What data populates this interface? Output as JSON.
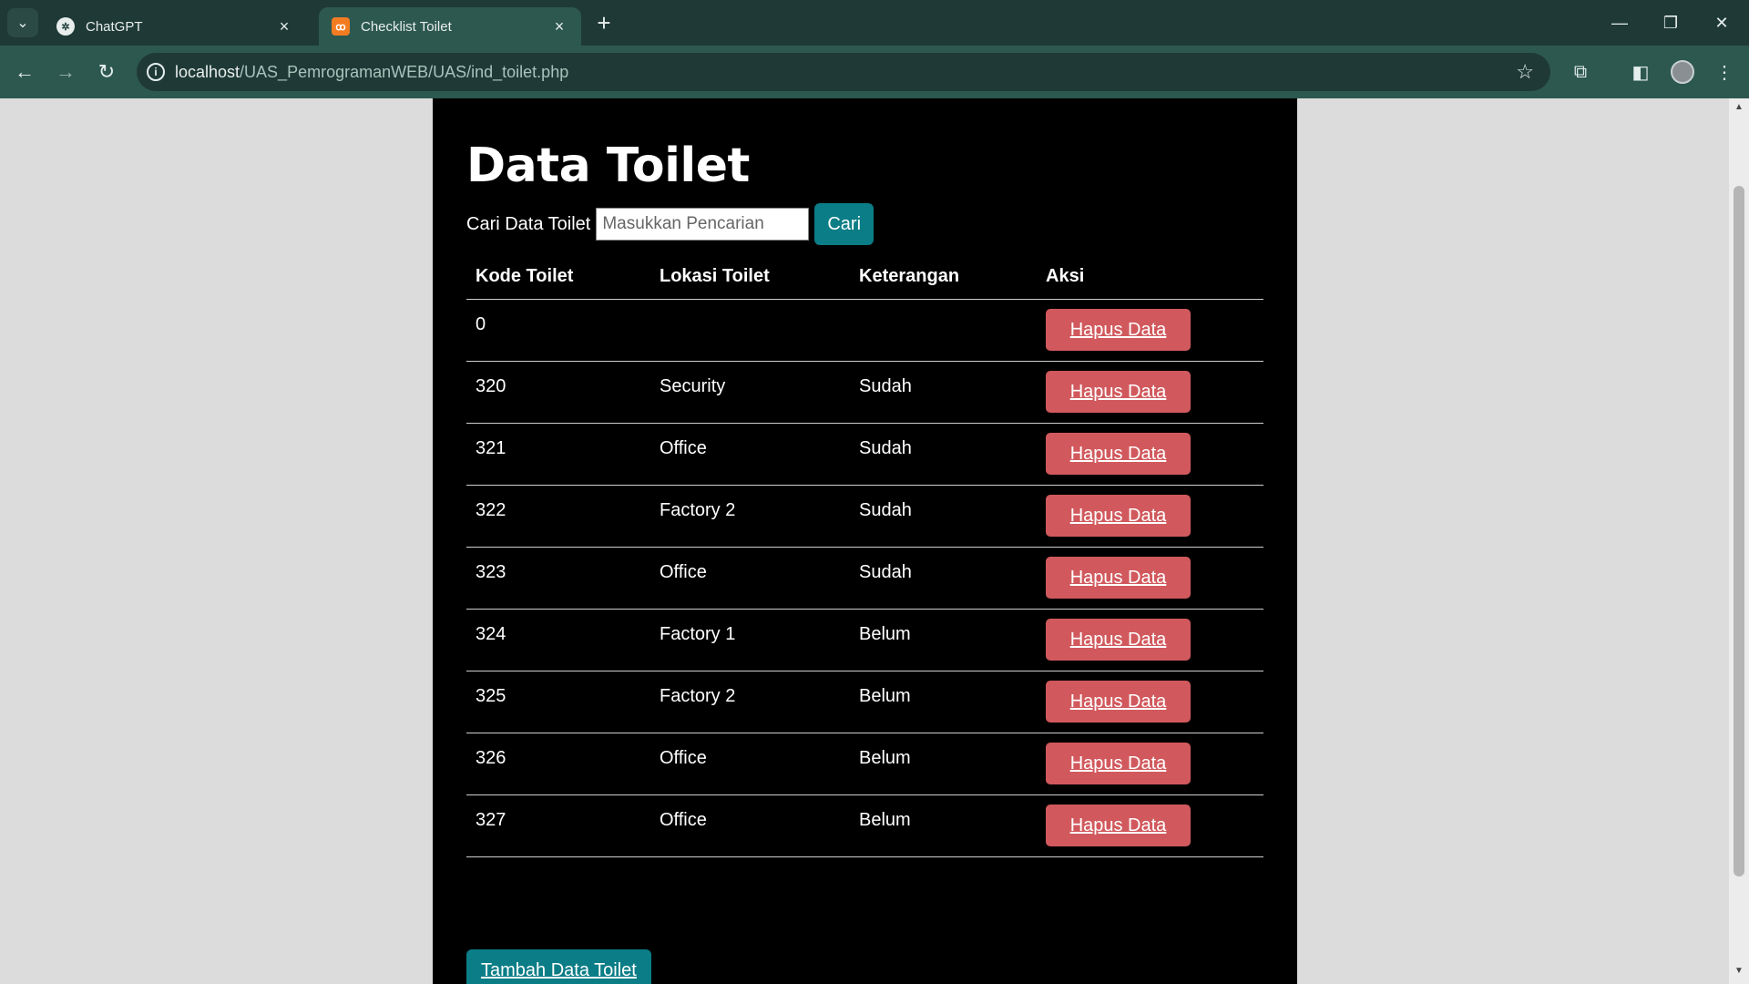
{
  "browser": {
    "tabs": [
      {
        "title": "ChatGPT",
        "favicon": "chatgpt-icon",
        "active": false
      },
      {
        "title": "Checklist Toilet",
        "favicon": "xampp-icon",
        "active": true
      }
    ],
    "url_host": "localhost",
    "url_path": "/UAS_PemrogramanWEB/UAS/ind_toilet.php"
  },
  "page": {
    "title": "Data Toilet",
    "search": {
      "label": "Cari Data Toilet",
      "placeholder": "Masukkan Pencarian",
      "value": "",
      "button": "Cari"
    },
    "table": {
      "headers": [
        "Kode Toilet",
        "Lokasi Toilet",
        "Keterangan",
        "Aksi"
      ],
      "rows": [
        {
          "kode": "0",
          "lokasi": "",
          "keterangan": "",
          "action": "Hapus Data"
        },
        {
          "kode": "320",
          "lokasi": "Security",
          "keterangan": "Sudah",
          "action": "Hapus Data"
        },
        {
          "kode": "321",
          "lokasi": "Office",
          "keterangan": "Sudah",
          "action": "Hapus Data"
        },
        {
          "kode": "322",
          "lokasi": "Factory 2",
          "keterangan": "Sudah",
          "action": "Hapus Data"
        },
        {
          "kode": "323",
          "lokasi": "Office",
          "keterangan": "Sudah",
          "action": "Hapus Data"
        },
        {
          "kode": "324",
          "lokasi": "Factory 1",
          "keterangan": "Belum",
          "action": "Hapus Data"
        },
        {
          "kode": "325",
          "lokasi": "Factory 2",
          "keterangan": "Belum",
          "action": "Hapus Data"
        },
        {
          "kode": "326",
          "lokasi": "Office",
          "keterangan": "Belum",
          "action": "Hapus Data"
        },
        {
          "kode": "327",
          "lokasi": "Office",
          "keterangan": "Belum",
          "action": "Hapus Data"
        }
      ]
    },
    "add_button": "Tambah Data Toilet"
  },
  "colors": {
    "accent": "#0b7d86",
    "danger": "#d1595d",
    "content_bg": "#000000",
    "chrome_bg": "#2d5850"
  }
}
